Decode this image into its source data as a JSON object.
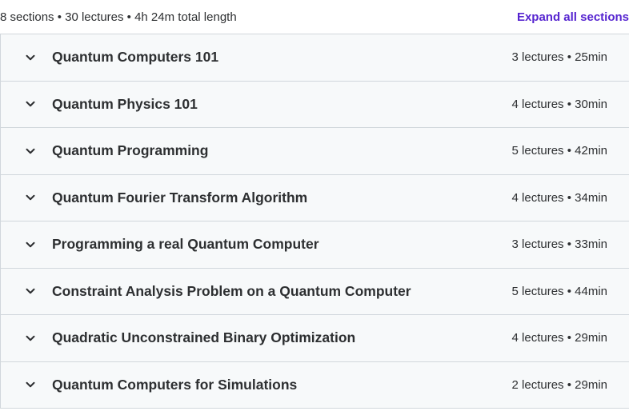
{
  "summary": {
    "text": "8 sections • 30 lectures • 4h 24m total length",
    "expand_label": "Expand all sections"
  },
  "icons": {
    "chevron": "chevron-down-icon"
  },
  "sections": [
    {
      "title": "Quantum Computers 101",
      "meta": "3 lectures • 25min"
    },
    {
      "title": "Quantum Physics 101",
      "meta": "4 lectures • 30min"
    },
    {
      "title": "Quantum Programming",
      "meta": "5 lectures • 42min"
    },
    {
      "title": "Quantum Fourier Transform Algorithm",
      "meta": "4 lectures • 34min"
    },
    {
      "title": "Programming a real Quantum Computer",
      "meta": "3 lectures • 33min"
    },
    {
      "title": "Constraint Analysis Problem on a Quantum Computer",
      "meta": "5 lectures • 44min"
    },
    {
      "title": "Quadratic Unconstrained Binary Optimization",
      "meta": "4 lectures • 29min"
    },
    {
      "title": "Quantum Computers for Simulations",
      "meta": "2 lectures • 29min"
    }
  ]
}
